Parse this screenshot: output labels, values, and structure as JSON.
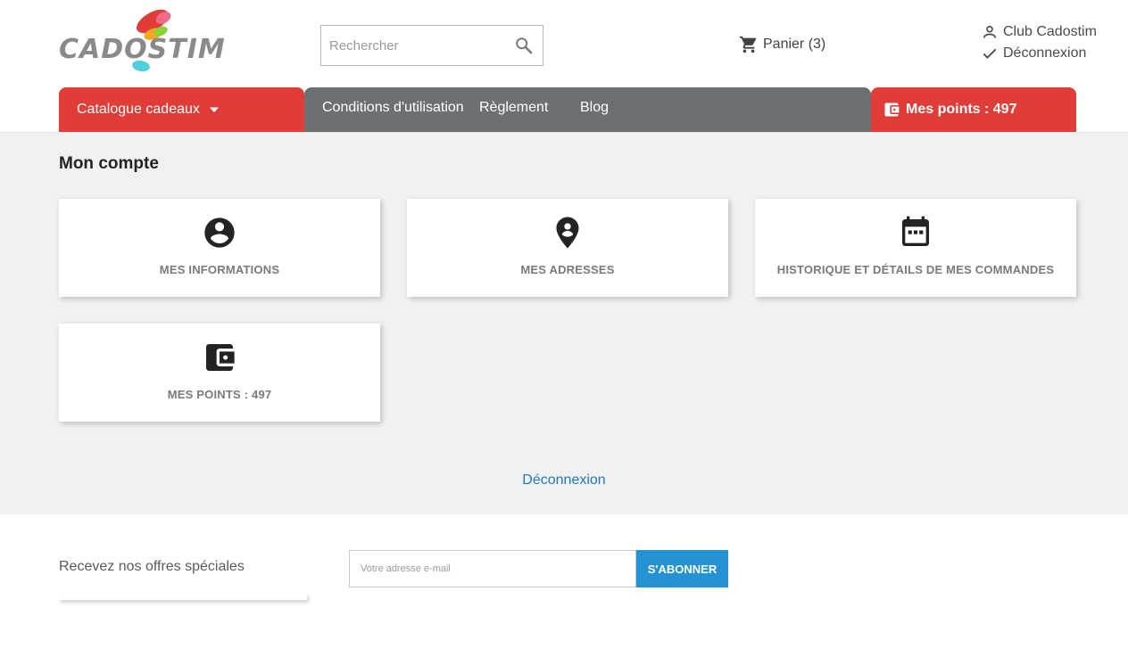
{
  "header": {
    "logo_text": "CADOSTIM",
    "search_placeholder": "Rechercher",
    "cart_label": "Panier (3)",
    "user_name": "Club Cadostim",
    "logout_label": "Déconnexion"
  },
  "nav": {
    "catalog_label": "Catalogue cadeaux",
    "links": [
      "Conditions d'utilisation",
      "Règlement",
      "Blog"
    ],
    "points_label": "Mes points : 497"
  },
  "main": {
    "title": "Mon compte",
    "cards": [
      {
        "label": "Mes informations",
        "icon": "account-circle-icon"
      },
      {
        "label": "Mes adresses",
        "icon": "location-pin-icon"
      },
      {
        "label": "Historique et détails de mes commandes",
        "icon": "calendar-icon"
      },
      {
        "label": "Mes points : 497",
        "icon": "wallet-icon"
      }
    ],
    "logout_link": "Déconnexion"
  },
  "footer": {
    "newsletter_text": "Recevez nos offres spéciales",
    "email_placeholder": "Votre adresse e-mail",
    "subscribe_label": "S'abonner"
  },
  "colors": {
    "accent_red": "#e03d38",
    "nav_grey": "#6c7073",
    "link_blue": "#2377b6",
    "button_blue": "#2592d6",
    "page_bg": "#f1f1f1"
  }
}
